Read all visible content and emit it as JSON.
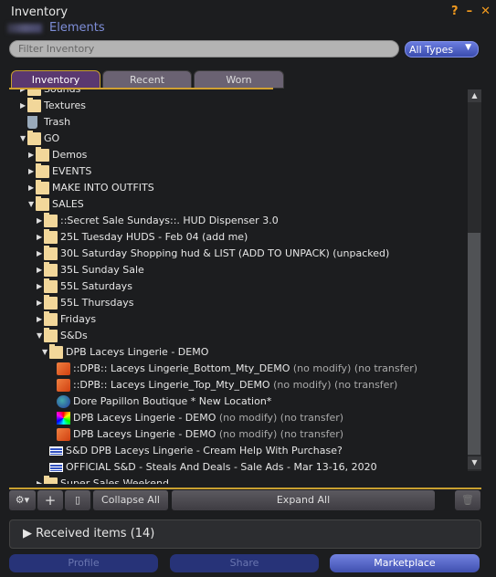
{
  "window": {
    "title": "Inventory",
    "owner": "Elements",
    "controls": [
      "?",
      "–",
      "✕"
    ]
  },
  "filter": {
    "placeholder": "Filter Inventory",
    "type_select": "All Types"
  },
  "tabs": [
    {
      "label": "Inventory",
      "active": true
    },
    {
      "label": "Recent"
    },
    {
      "label": "Worn"
    }
  ],
  "tree": [
    {
      "label": "Sounds",
      "level": 0,
      "icon": "folder-star",
      "arrow": "closed"
    },
    {
      "label": "Textures",
      "level": 0,
      "icon": "folder-star",
      "arrow": "closed"
    },
    {
      "label": "Trash",
      "level": 0,
      "icon": "trash"
    },
    {
      "label": "GO",
      "level": 0,
      "icon": "folder-open",
      "arrow": "open"
    },
    {
      "label": "Demos",
      "level": 1,
      "icon": "folder",
      "arrow": "closed"
    },
    {
      "label": "EVENTS",
      "level": 1,
      "icon": "folder",
      "arrow": "closed"
    },
    {
      "label": "MAKE INTO OUTFITS",
      "level": 1,
      "icon": "folder",
      "arrow": "closed"
    },
    {
      "label": "SALES",
      "level": 1,
      "icon": "folder-open",
      "arrow": "open"
    },
    {
      "label": "::Secret Sale Sundays::. HUD Dispenser 3.0",
      "level": 2,
      "icon": "folder",
      "arrow": "closed"
    },
    {
      "label": "25L Tuesday HUDS - Feb 04 (add me)",
      "level": 2,
      "icon": "folder",
      "arrow": "closed"
    },
    {
      "label": "30L Saturday Shopping hud & LIST (ADD TO UNPACK) (unpacked)",
      "level": 2,
      "icon": "folder",
      "arrow": "closed"
    },
    {
      "label": "35L Sunday Sale",
      "level": 2,
      "icon": "folder",
      "arrow": "closed"
    },
    {
      "label": "55L Saturdays",
      "level": 2,
      "icon": "folder",
      "arrow": "closed"
    },
    {
      "label": "55L Thursdays",
      "level": 2,
      "icon": "folder",
      "arrow": "closed"
    },
    {
      "label": "Fridays",
      "level": 2,
      "icon": "folder",
      "arrow": "closed"
    },
    {
      "label": "S&Ds",
      "level": 2,
      "icon": "folder-open",
      "arrow": "open"
    },
    {
      "label": "DPB Laceys Lingerie - DEMO",
      "level": 3,
      "icon": "folder-open",
      "arrow": "open"
    },
    {
      "label": "::DPB:: Laceys Lingerie_Bottom_Mty_DEMO",
      "suffix": " (no modify) (no transfer)",
      "level": 4,
      "icon": "object"
    },
    {
      "label": "::DPB:: Laceys Lingerie_Top_Mty_DEMO",
      "suffix": " (no modify) (no transfer)",
      "level": 4,
      "icon": "object"
    },
    {
      "label": "Dore Papillon Boutique * New Location*",
      "level": 4,
      "icon": "landmark"
    },
    {
      "label": "DPB Laceys Lingerie - DEMO",
      "suffix": " (no modify) (no transfer)",
      "level": 4,
      "icon": "texture"
    },
    {
      "label": "DPB Laceys Lingerie - DEMO",
      "suffix": " (no modify) (no transfer)",
      "level": 4,
      "icon": "object"
    },
    {
      "label": "S&D DPB Laceys Lingerie - Cream Help With Purchase?",
      "level": 3,
      "icon": "notecard"
    },
    {
      "label": "OFFICIAL S&D - Steals And Deals - Sale Ads - Mar 13-16, 2020",
      "level": 3,
      "icon": "notecard"
    },
    {
      "label": "Super Sales Weekend",
      "level": 2,
      "icon": "folder",
      "arrow": "closed"
    }
  ],
  "toolbar": {
    "gear": "⚙▾",
    "add": "+",
    "collapse": "Collapse All",
    "expand": "Expand All"
  },
  "received": {
    "label": "Received items (14)"
  },
  "footer": {
    "profile": "Profile",
    "share": "Share",
    "marketplace": "Marketplace"
  }
}
